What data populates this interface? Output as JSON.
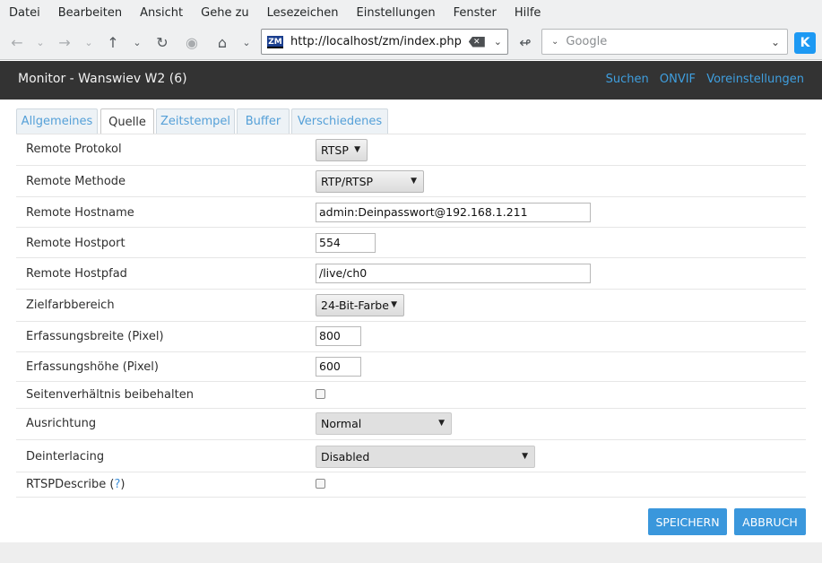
{
  "menubar": [
    "Datei",
    "Bearbeiten",
    "Ansicht",
    "Gehe zu",
    "Lesezeichen",
    "Einstellungen",
    "Fenster",
    "Hilfe"
  ],
  "browser": {
    "favicon_text": "ZM",
    "url": "http://localhost/zm/index.php",
    "search_placeholder": "Google"
  },
  "app": {
    "title": "Monitor - Wanswiev W2 (6)",
    "links": [
      "Suchen",
      "ONVIF",
      "Voreinstellungen"
    ]
  },
  "tabs": [
    "Allgemeines",
    "Quelle",
    "Zeitstempel",
    "Buffer",
    "Verschiedenes"
  ],
  "active_tab": "Quelle",
  "form": {
    "remote_protokol": {
      "label": "Remote Protokol",
      "value": "RTSP"
    },
    "remote_methode": {
      "label": "Remote Methode",
      "value": "RTP/RTSP"
    },
    "remote_hostname": {
      "label": "Remote Hostname",
      "value": "admin:Deinpasswort@192.168.1.211"
    },
    "remote_hostport": {
      "label": "Remote Hostport",
      "value": "554"
    },
    "remote_hostpfad": {
      "label": "Remote Hostpfad",
      "value": "/live/ch0"
    },
    "zielfarbbereich": {
      "label": "Zielfarbbereich",
      "value": "24-Bit-Farbe"
    },
    "erfassungsbreite": {
      "label": "Erfassungsbreite (Pixel)",
      "value": "800"
    },
    "erfassungshoehe": {
      "label": "Erfassungshöhe (Pixel)",
      "value": "600"
    },
    "seitenverhaeltnis": {
      "label": "Seitenverhältnis beibehalten",
      "checked": false
    },
    "ausrichtung": {
      "label": "Ausrichtung",
      "value": "Normal"
    },
    "deinterlacing": {
      "label": "Deinterlacing",
      "value": "Disabled"
    },
    "rtspdescribe": {
      "label": "RTSPDescribe",
      "help_open": " (",
      "help": "?",
      "help_close": ")",
      "checked": false
    }
  },
  "buttons": {
    "save": "SPEICHERN",
    "cancel": "ABBRUCH"
  },
  "colors": {
    "accent": "#3a97dc",
    "header_bg": "#333333",
    "link": "#3f9fdf"
  }
}
